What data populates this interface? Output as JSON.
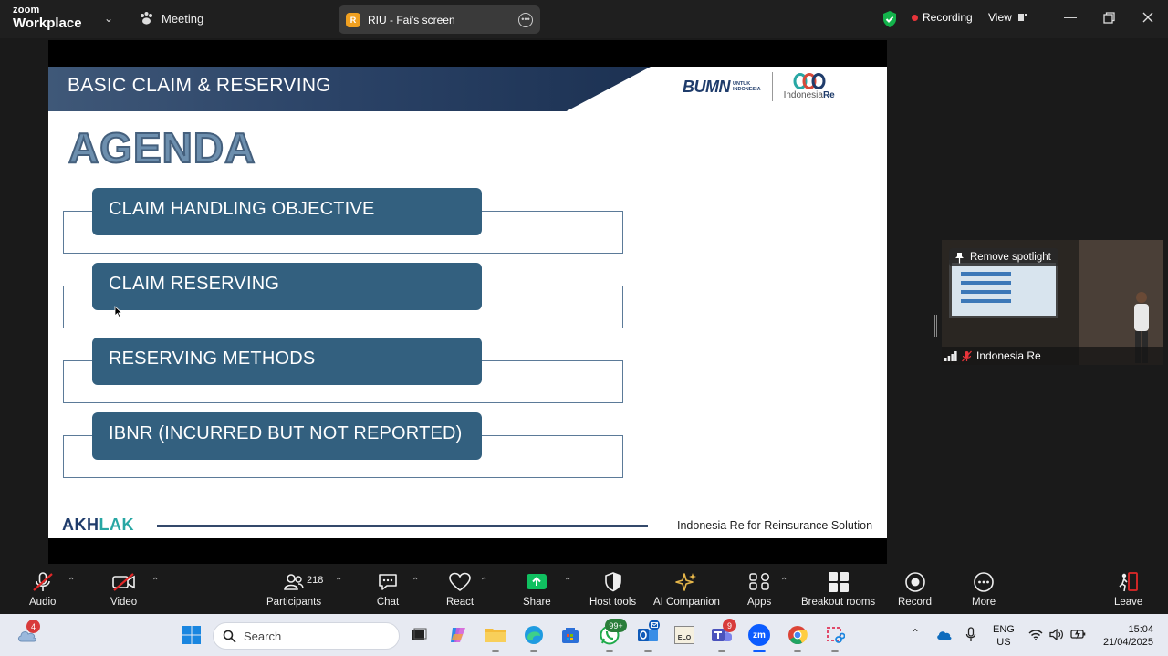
{
  "window": {
    "app_logo_line1": "zoom",
    "app_logo_line2": "Workplace",
    "meeting_label": "Meeting",
    "share_icon_letter": "R",
    "share_title": "RIU - Fai's screen",
    "recording_label": "Recording",
    "view_label": "View"
  },
  "slide": {
    "banner_title": "BASIC CLAIM & RESERVING",
    "logo_bumn": "BUMN",
    "logo_bumn_sub1": "UNTUK",
    "logo_bumn_sub2": "INDONESIA",
    "logo_ire_1": "Indonesia",
    "logo_ire_2": "Re",
    "heading": "AGENDA",
    "items": [
      "CLAIM HANDLING OBJECTIVE",
      "CLAIM RESERVING",
      "RESERVING METHODS",
      "IBNR (INCURRED BUT NOT REPORTED)"
    ],
    "footer_brand_1": "AKH",
    "footer_brand_2": "LAK",
    "tagline": "Indonesia Re for Reinsurance Solution"
  },
  "spotlight": {
    "remove_label": "Remove spotlight",
    "participant_name": "Indonesia Re"
  },
  "toolbar": {
    "audio": "Audio",
    "video": "Video",
    "participants": "Participants",
    "participants_count": "218",
    "chat": "Chat",
    "react": "React",
    "share": "Share",
    "host_tools": "Host tools",
    "ai_companion": "AI Companion",
    "apps": "Apps",
    "breakout_rooms": "Breakout rooms",
    "record": "Record",
    "more": "More",
    "leave": "Leave"
  },
  "taskbar": {
    "weather_badge": "4",
    "search_placeholder": "Search",
    "whatsapp_badge": "99+",
    "teams_badge": "9",
    "elo_label": "ELO",
    "zoom_label": "zm",
    "lang_line1": "ENG",
    "lang_line2": "US",
    "time": "15:04",
    "date": "21/04/2025"
  },
  "colors": {
    "slide_banner": "#2a4266",
    "agenda_item": "#33607f",
    "share_green": "#10c060",
    "recording_red": "#e8343a",
    "leave_red": "#e02828"
  }
}
